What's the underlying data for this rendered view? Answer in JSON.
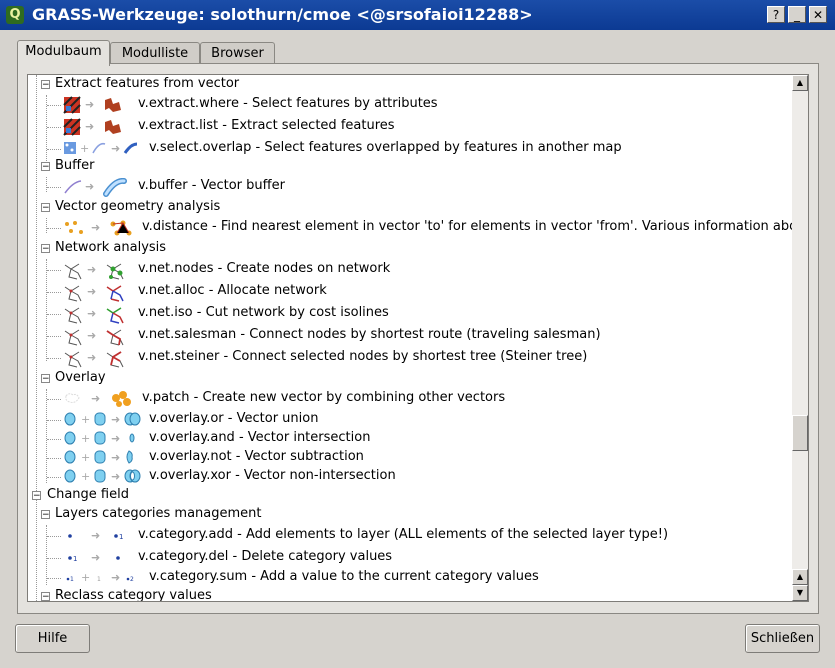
{
  "window": {
    "title": "GRASS-Werkzeuge: solothurn/cmoe <@srsofaioi12288>",
    "app_icon": "Q",
    "help_glyph": "?",
    "minimize_glyph": "_",
    "maximize_glyph": "□",
    "close_glyph": "✕"
  },
  "tabs": [
    {
      "label": "Modulbaum",
      "active": true
    },
    {
      "label": "Modulliste",
      "active": false
    },
    {
      "label": "Browser",
      "active": false
    }
  ],
  "tree": {
    "categories": {
      "extract": "Extract features from vector",
      "buffer": "Buffer",
      "geometry": "Vector geometry analysis",
      "network": "Network analysis",
      "overlay": "Overlay",
      "change_field": "Change field",
      "layers": "Layers categories management",
      "reclass": "Reclass category values"
    },
    "modules": {
      "extract_where": "v.extract.where - Select features by attributes",
      "extract_list": "v.extract.list - Extract selected features",
      "select_overlap": "v.select.overlap - Select features overlapped by features in another map",
      "buffer": "v.buffer - Vector buffer",
      "distance": "v.distance - Find nearest element in vector 'to' for elements in vector 'from'. Various information abo...",
      "net_nodes": "v.net.nodes - Create nodes on network",
      "net_alloc": "v.net.alloc - Allocate network",
      "net_iso": "v.net.iso - Cut network by cost isolines",
      "net_salesman": "v.net.salesman - Connect nodes by shortest route (traveling salesman)",
      "net_steiner": "v.net.steiner - Connect selected nodes by shortest tree (Steiner tree)",
      "patch": "v.patch - Create new vector by combining other vectors",
      "overlay_or": "v.overlay.or - Vector union",
      "overlay_and": "v.overlay.and - Vector intersection",
      "overlay_not": "v.overlay.not - Vector subtraction",
      "overlay_xor": "v.overlay.xor - Vector non-intersection",
      "category_add": "v.category.add - Add elements to layer (ALL elements of the selected layer type!)",
      "category_del": "v.category.del - Delete category values",
      "category_sum": "v.category.sum - Add a value to the current category values"
    },
    "expander_glyph": "−",
    "arrow_glyph": "➜",
    "plus_glyph": "+"
  },
  "buttons": {
    "help": "Hilfe",
    "close": "Schließen"
  }
}
